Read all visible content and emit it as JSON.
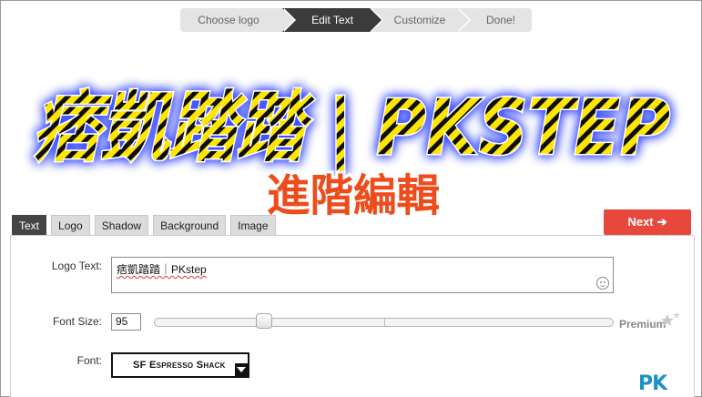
{
  "steps": [
    {
      "label": "Choose logo",
      "state": "done"
    },
    {
      "label": "Edit Text",
      "state": "active"
    },
    {
      "label": "Customize",
      "state": "todo"
    },
    {
      "label": "Done!",
      "state": "todo"
    }
  ],
  "preview": {
    "logo_text": "痞凱踏踏 | PKSTEP",
    "fill_colors": [
      "#ffe600",
      "#111111"
    ],
    "glow_color": "#3a4cff"
  },
  "caption": {
    "text": "進階編輯",
    "color": "#ee4c1c",
    "outline": "#ffffff"
  },
  "tabs": [
    "Text",
    "Logo",
    "Shadow",
    "Background",
    "Image"
  ],
  "active_tab": "Text",
  "next_button": {
    "label": "Next",
    "icon": "arrow-right-icon",
    "color": "#e8483c"
  },
  "form": {
    "logo_text_label": "Logo Text:",
    "logo_text_value": "痞凱踏踏｜PKstep",
    "font_size_label": "Font Size:",
    "font_size_value": "95",
    "font_size_slider_fraction": 0.23,
    "premium_label": "Premium",
    "font_label": "Font:",
    "font_value": "SF Espresso Shack"
  },
  "watermark": {
    "text": "PK"
  }
}
